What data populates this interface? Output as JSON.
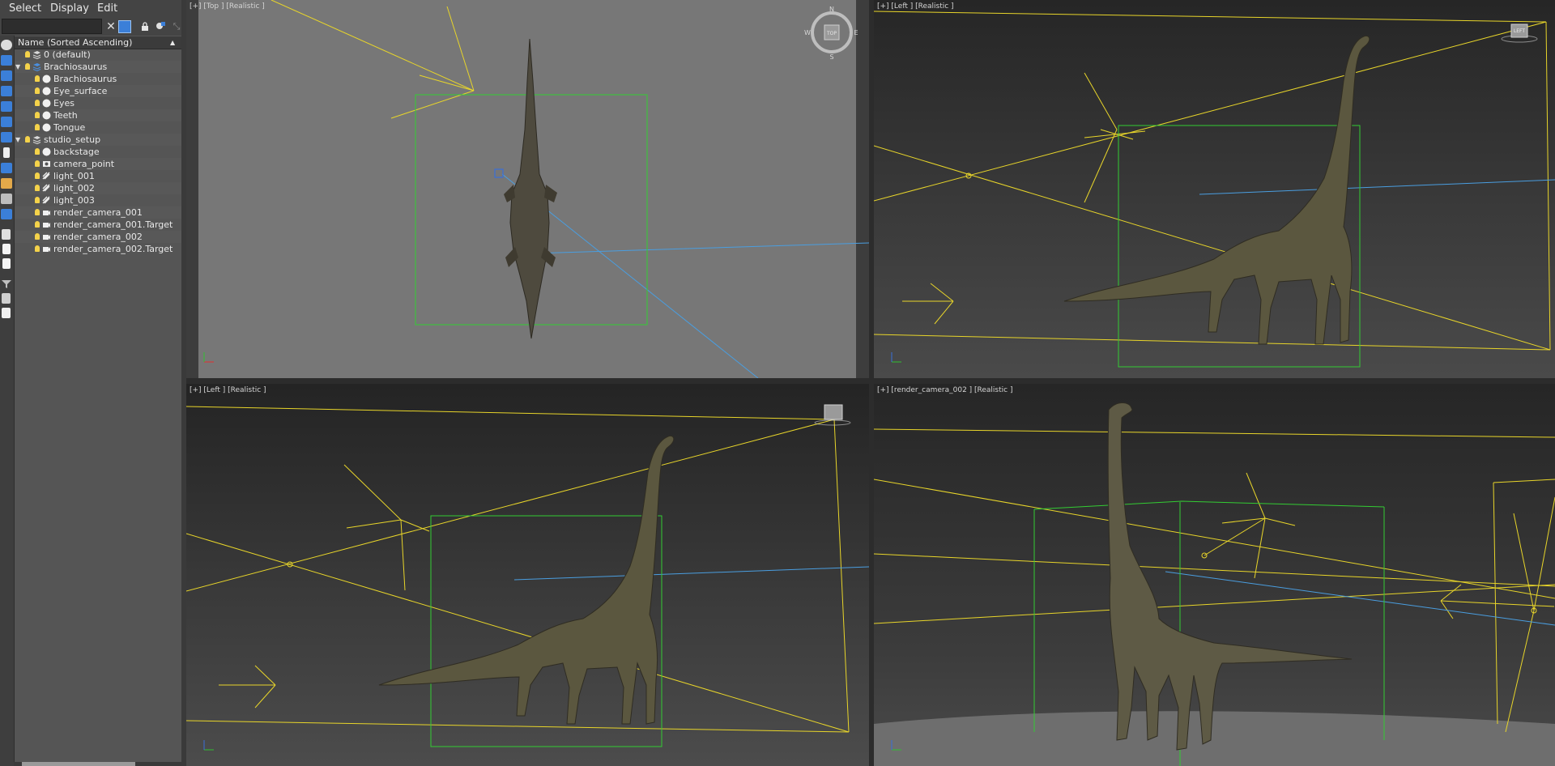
{
  "menu": {
    "select": "Select",
    "display": "Display",
    "edit": "Edit"
  },
  "explorer": {
    "column_header": "Name (Sorted Ascending)",
    "rows": [
      {
        "label": "0 (default)",
        "depth": 0,
        "icon": "layer-icon",
        "expand": "",
        "checked": true
      },
      {
        "label": "Brachiosaurus",
        "depth": 0,
        "icon": "layer-icon",
        "expand": "▼",
        "selected": true
      },
      {
        "label": "Brachiosaurus",
        "depth": 1,
        "icon": "object-icon"
      },
      {
        "label": "Eye_surface",
        "depth": 1,
        "icon": "object-icon"
      },
      {
        "label": "Eyes",
        "depth": 1,
        "icon": "object-icon"
      },
      {
        "label": "Teeth",
        "depth": 1,
        "icon": "object-icon"
      },
      {
        "label": "Tongue",
        "depth": 1,
        "icon": "object-icon"
      },
      {
        "label": "studio_setup",
        "depth": 0,
        "icon": "layer-icon",
        "expand": "▼"
      },
      {
        "label": "backstage",
        "depth": 1,
        "icon": "object-icon"
      },
      {
        "label": "camera_point",
        "depth": 1,
        "icon": "point-icon"
      },
      {
        "label": "light_001",
        "depth": 1,
        "icon": "light-icon"
      },
      {
        "label": "light_002",
        "depth": 1,
        "icon": "light-icon"
      },
      {
        "label": "light_003",
        "depth": 1,
        "icon": "light-icon"
      },
      {
        "label": "render_camera_001",
        "depth": 1,
        "icon": "camera-icon"
      },
      {
        "label": "render_camera_001.Target",
        "depth": 1,
        "icon": "camera-icon"
      },
      {
        "label": "render_camera_002",
        "depth": 1,
        "icon": "camera-icon"
      },
      {
        "label": "render_camera_002.Target",
        "depth": 1,
        "icon": "camera-icon"
      }
    ]
  },
  "viewports": {
    "top": {
      "label": "[+] [Top ] [Realistic ]",
      "viewcube": "TOP"
    },
    "left_top": {
      "label": "[+] [Left ] [Realistic ]",
      "viewcube": "LEFT"
    },
    "left_bottom": {
      "label": "[+] [Left ] [Realistic ]"
    },
    "camera": {
      "label": "[+] [render_camera_002 ] [Realistic ]"
    }
  },
  "colors": {
    "panel_bg": "#444444",
    "list_bg": "#555555",
    "selection": "#ffd400",
    "bbox": "#33cc33",
    "camera_line": "#4a9ee0",
    "viewport_active": "#c9a63a",
    "viewport_bg_top": "#777777",
    "viewport_bg_dark": "#3a3a3a"
  }
}
